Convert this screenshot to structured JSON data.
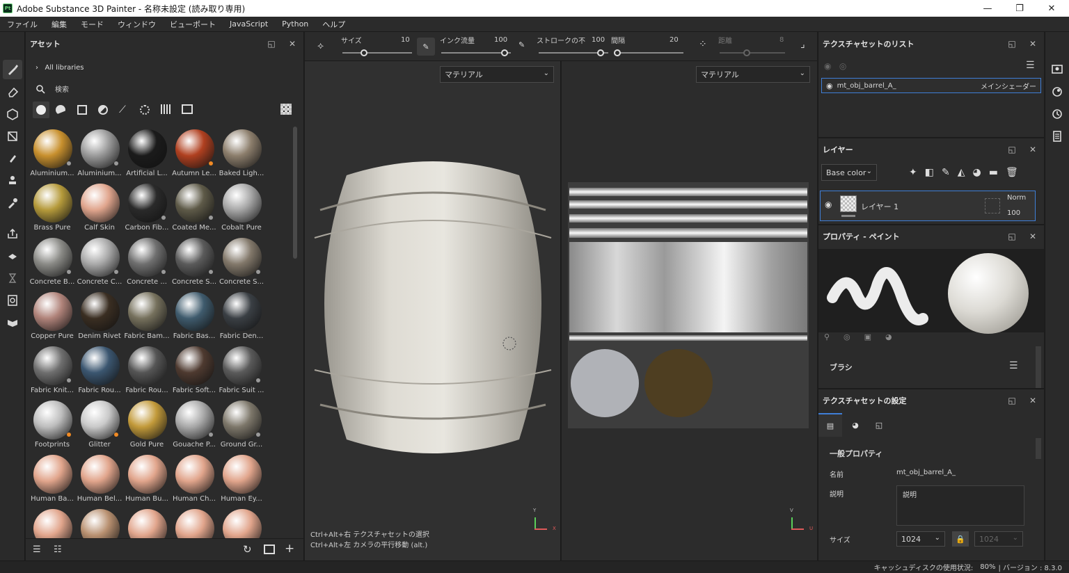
{
  "window": {
    "title": "Adobe Substance 3D Painter - 名称未設定 (読み取り専用)",
    "logo": "Pt",
    "minimize": "—",
    "maximize": "❐",
    "close": "✕"
  },
  "menu": [
    "ファイル",
    "編集",
    "モード",
    "ウィンドウ",
    "ビューポート",
    "JavaScript",
    "Python",
    "ヘルプ"
  ],
  "assets": {
    "title": "アセット",
    "breadcrumb": "All libraries",
    "search_placeholder": "検索",
    "items": [
      {
        "label": "Aluminium...",
        "color": "#c8902e",
        "badge": "dots"
      },
      {
        "label": "Aluminium...",
        "color": "#9b9b9b",
        "badge": "dots"
      },
      {
        "label": "Artificial L...",
        "color": "#1b1b1b",
        "badge": ""
      },
      {
        "label": "Autumn Le...",
        "color": "#b04020",
        "badge": "orange"
      },
      {
        "label": "Baked Ligh...",
        "color": "#8c7e6c",
        "badge": ""
      },
      {
        "label": "Brass Pure",
        "color": "#b59a3b",
        "badge": ""
      },
      {
        "label": "Calf Skin",
        "color": "#e0a58d",
        "badge": ""
      },
      {
        "label": "Carbon Fib...",
        "color": "#2a2a2a",
        "badge": "dots"
      },
      {
        "label": "Coated Me...",
        "color": "#5e5a48",
        "badge": "dots"
      },
      {
        "label": "Cobalt Pure",
        "color": "#a7a7a7",
        "badge": ""
      },
      {
        "label": "Concrete B...",
        "color": "#8a8a86",
        "badge": "dots"
      },
      {
        "label": "Concrete C...",
        "color": "#a9a9a9",
        "badge": "dots"
      },
      {
        "label": "Concrete ...",
        "color": "#6f6f6f",
        "badge": "dots"
      },
      {
        "label": "Concrete S...",
        "color": "#5b5b5b",
        "badge": "dots"
      },
      {
        "label": "Concrete S...",
        "color": "#82786a",
        "badge": "dots"
      },
      {
        "label": "Copper Pure",
        "color": "#b0837a",
        "badge": ""
      },
      {
        "label": "Denim Rivet",
        "color": "#3a2e22",
        "badge": ""
      },
      {
        "label": "Fabric Bam...",
        "color": "#76715d",
        "badge": ""
      },
      {
        "label": "Fabric Bas...",
        "color": "#3f5b6d",
        "badge": ""
      },
      {
        "label": "Fabric Den...",
        "color": "#3a3f44",
        "badge": ""
      },
      {
        "label": "Fabric Knit...",
        "color": "#6f6f6f",
        "badge": "dots"
      },
      {
        "label": "Fabric Rou...",
        "color": "#3b5670",
        "badge": ""
      },
      {
        "label": "Fabric Rou...",
        "color": "#555555",
        "badge": ""
      },
      {
        "label": "Fabric Soft...",
        "color": "#4e3a30",
        "badge": ""
      },
      {
        "label": "Fabric Suit ...",
        "color": "#5a5a5a",
        "badge": "dots"
      },
      {
        "label": "Footprints",
        "color": "#bdbdbd",
        "badge": "orange"
      },
      {
        "label": "Glitter",
        "color": "#c9c9c9",
        "badge": "orange"
      },
      {
        "label": "Gold Pure",
        "color": "#c29a3a",
        "badge": ""
      },
      {
        "label": "Gouache P...",
        "color": "#a9a9a9",
        "badge": "dots"
      },
      {
        "label": "Ground Gr...",
        "color": "#7d776a",
        "badge": "dots"
      },
      {
        "label": "Human Ba...",
        "color": "#e1a58c",
        "badge": ""
      },
      {
        "label": "Human Bel...",
        "color": "#e1a58c",
        "badge": ""
      },
      {
        "label": "Human Bu...",
        "color": "#e1a58c",
        "badge": ""
      },
      {
        "label": "Human Ch...",
        "color": "#e1a58c",
        "badge": ""
      },
      {
        "label": "Human Ey...",
        "color": "#e1a58c",
        "badge": ""
      },
      {
        "label": "",
        "color": "#e1a58c",
        "badge": ""
      },
      {
        "label": "",
        "color": "#b89070",
        "badge": ""
      },
      {
        "label": "",
        "color": "#e1a58c",
        "badge": ""
      },
      {
        "label": "",
        "color": "#e1a58c",
        "badge": ""
      },
      {
        "label": "",
        "color": "#e1a58c",
        "badge": ""
      }
    ]
  },
  "toolbar": {
    "size_label": "サイズ",
    "size_value": "10",
    "flow_label": "インク流量",
    "flow_value": "100",
    "stroke_label": "ストロークの不",
    "stroke_value": "100",
    "spacing_label": "間隔",
    "spacing_value": "20",
    "distance_label": "距離",
    "distance_value": "8"
  },
  "viewport3d": {
    "material_dropdown": "マテリアル",
    "hint1": "Ctrl+Alt+右  テクスチャセットの選択",
    "hint2": "Ctrl+Alt+左  カメラの平行移動 (alt.)",
    "axis_y": "Y",
    "axis_x": "X"
  },
  "viewport2d": {
    "material_dropdown": "マテリアル",
    "axis_v": "V",
    "axis_u": "U"
  },
  "texture_list": {
    "title": "テクスチャセットのリスト",
    "item_name": "mt_obj_barrel_A_",
    "item_shader": "メインシェーダー"
  },
  "layers": {
    "title": "レイヤー",
    "channel": "Base color",
    "layer_name": "レイヤー 1",
    "blend": "Norm",
    "opacity": "100"
  },
  "properties": {
    "title": "プロパティ - ペイント",
    "section": "ブラシ"
  },
  "texture_settings": {
    "title": "テクスチャセットの設定",
    "section": "一般プロパティ",
    "name_label": "名前",
    "name_value": "mt_obj_barrel_A_",
    "desc_label": "説明",
    "desc_value": "説明",
    "size_label": "サイズ",
    "size_value": "1024",
    "size_value2": "1024"
  },
  "status": {
    "text": "キャッシュディスクの使用状況:",
    "usage": "80%",
    "version": "| バージョン : 8.3.0"
  }
}
